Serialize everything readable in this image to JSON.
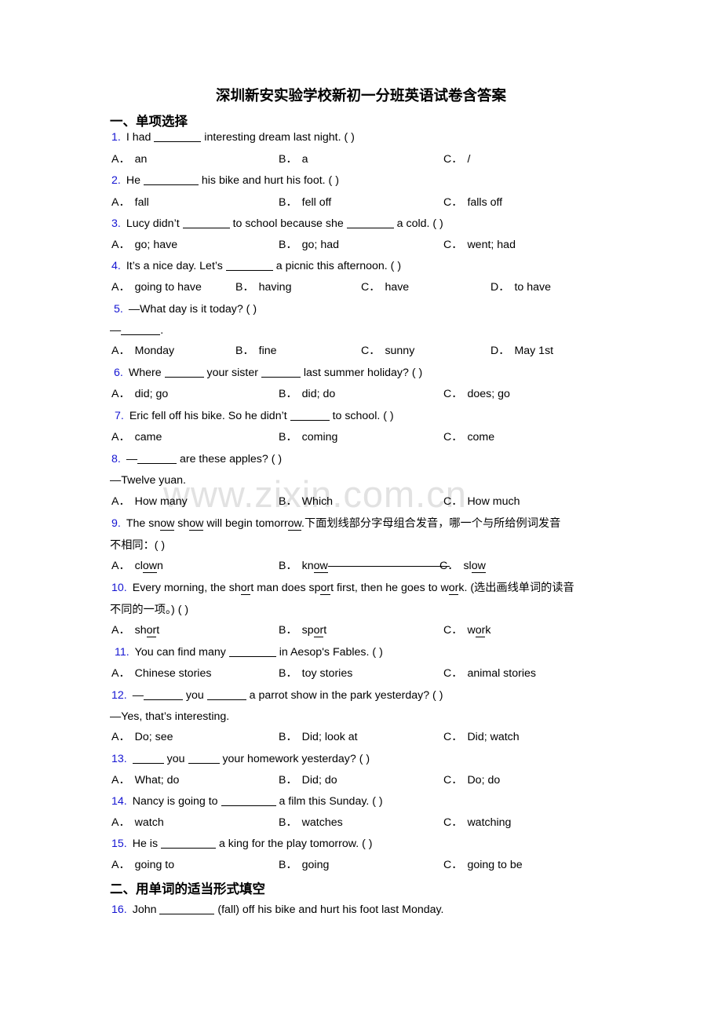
{
  "document": {
    "title": "深圳新安实验学校新初一分班英语试卷含答案",
    "watermark": "www.zixin.com.cn",
    "accent_color": "#1414d2"
  },
  "sections": [
    {
      "id": "s1",
      "heading": "一、单项选择"
    },
    {
      "id": "s2",
      "heading": "二、用单词的适当形式填空"
    }
  ],
  "questions": [
    {
      "num": "1.",
      "stem_pre": "I had ",
      "stem_post": " interesting dream last night. (   )",
      "options": [
        {
          "letter": "A．",
          "text": "an"
        },
        {
          "letter": "B．",
          "text": "a"
        },
        {
          "letter": "C．",
          "text": "/"
        }
      ]
    },
    {
      "num": "2.",
      "stem_pre": "He ",
      "stem_post": " his bike and hurt his foot. (  )",
      "options": [
        {
          "letter": "A．",
          "text": "fall"
        },
        {
          "letter": "B．",
          "text": "fell off"
        },
        {
          "letter": "C．",
          "text": "falls off"
        }
      ]
    },
    {
      "num": "3.",
      "stem_pre": "Lucy didn’t ",
      "stem_mid": " to school because she ",
      "stem_post": " a cold. (  )",
      "options": [
        {
          "letter": "A．",
          "text": "go; have"
        },
        {
          "letter": "B．",
          "text": "go; had"
        },
        {
          "letter": "C．",
          "text": "went; had"
        }
      ]
    },
    {
      "num": "4.",
      "stem_pre": "It’s a nice day. Let’s ",
      "stem_post": " a picnic this afternoon. (   )",
      "options": [
        {
          "letter": "A．",
          "text": "going to have"
        },
        {
          "letter": "B．",
          "text": "having"
        },
        {
          "letter": "C．",
          "text": "have"
        },
        {
          "letter": "D．",
          "text": "to have"
        }
      ]
    },
    {
      "num": "5.",
      "stem_pre": "—What day is it today? (  )",
      "stem_second": "—",
      "stem_second_post": ".",
      "options": [
        {
          "letter": "A．",
          "text": "Monday"
        },
        {
          "letter": "B．",
          "text": "fine"
        },
        {
          "letter": "C．",
          "text": "sunny"
        },
        {
          "letter": "D．",
          "text": "May 1st"
        }
      ]
    },
    {
      "num": "6.",
      "stem_pre": "Where ",
      "stem_mid": " your sister ",
      "stem_post": " last summer holiday? (  )",
      "options": [
        {
          "letter": "A．",
          "text": "did; go"
        },
        {
          "letter": "B．",
          "text": "did; do"
        },
        {
          "letter": "C．",
          "text": "does; go"
        }
      ]
    },
    {
      "num": "7.",
      "stem_pre": "Eric fell off his bike. So he didn’t ",
      "stem_post": " to school. (   )",
      "options": [
        {
          "letter": "A．",
          "text": "came"
        },
        {
          "letter": "B．",
          "text": "coming"
        },
        {
          "letter": "C．",
          "text": "come"
        }
      ]
    },
    {
      "num": "8.",
      "stem_pre": "—",
      "stem_post": " are these apples? (   )",
      "stem_second": "—Twelve yuan.",
      "options": [
        {
          "letter": "A．",
          "text": "How many"
        },
        {
          "letter": "B．",
          "text": "Which"
        },
        {
          "letter": "C．",
          "text": "How much"
        }
      ]
    },
    {
      "num": "9.",
      "stem_p1": "The sn",
      "stem_u1": "ow",
      "stem_p2": " sh",
      "stem_u2": "ow",
      "stem_p3": " will begin tomorr",
      "stem_u3": "ow",
      "stem_p4": ".下面划线部分字母组合发音，哪一个与所给例词发音",
      "stem_line2": "不相同：(  )",
      "options": [
        {
          "letter": "A．",
          "pre": "cl",
          "ul": "ow",
          "post": "n"
        },
        {
          "letter": "B．",
          "pre": "kn",
          "ul": "ow",
          "post": ""
        },
        {
          "letter": "C．",
          "pre": "sl",
          "ul": "ow",
          "post": ""
        }
      ]
    },
    {
      "num": "10.",
      "stem_p1": "Every morning, the sh",
      "stem_u1": "or",
      "stem_p2": "t man does sp",
      "stem_u2": "or",
      "stem_p3": "t first, then he goes to w",
      "stem_u3": "or",
      "stem_p4": "k. (选出画线单词的读音",
      "stem_line2": "不同的一项。) (  )",
      "options": [
        {
          "letter": "A．",
          "pre": "sh",
          "ul": "or",
          "post": "t"
        },
        {
          "letter": "B．",
          "pre": "sp",
          "ul": "or",
          "post": "t"
        },
        {
          "letter": "C．",
          "pre": "w",
          "ul": "or",
          "post": "k"
        }
      ]
    },
    {
      "num": "11.",
      "stem_pre": "You can find many ",
      "stem_post": " in Aesop's Fables. (  )",
      "options": [
        {
          "letter": "A．",
          "text": "Chinese stories"
        },
        {
          "letter": "B．",
          "text": "toy stories"
        },
        {
          "letter": "C．",
          "text": "animal stories"
        }
      ]
    },
    {
      "num": "12.",
      "stem_pre": "—",
      "stem_mid": " you ",
      "stem_post": " a parrot show in the park yesterday? (  )",
      "stem_second": "—Yes, that’s interesting.",
      "options": [
        {
          "letter": "A．",
          "text": "Do; see"
        },
        {
          "letter": "B．",
          "text": "Did; look at"
        },
        {
          "letter": "C．",
          "text": "Did; watch"
        }
      ]
    },
    {
      "num": "13.",
      "stem_pre": "",
      "stem_mid": " you ",
      "stem_post": " your homework yesterday? (  )",
      "options": [
        {
          "letter": "A．",
          "text": "What; do"
        },
        {
          "letter": "B．",
          "text": "Did; do"
        },
        {
          "letter": "C．",
          "text": "Do; do"
        }
      ]
    },
    {
      "num": "14.",
      "stem_pre": "Nancy is going to ",
      "stem_post": " a film this Sunday. (   )",
      "options": [
        {
          "letter": "A．",
          "text": "watch"
        },
        {
          "letter": "B．",
          "text": "watches"
        },
        {
          "letter": "C．",
          "text": "watching"
        }
      ]
    },
    {
      "num": "15.",
      "stem_pre": "He is ",
      "stem_post": " a king for the play tomorrow. (   )",
      "options": [
        {
          "letter": "A．",
          "text": "going to"
        },
        {
          "letter": "B．",
          "text": "going"
        },
        {
          "letter": "C．",
          "text": "going to be"
        }
      ]
    },
    {
      "num": "16.",
      "stem_pre": "John ",
      "stem_post": " (fall) off his bike and hurt his foot last Monday."
    }
  ]
}
